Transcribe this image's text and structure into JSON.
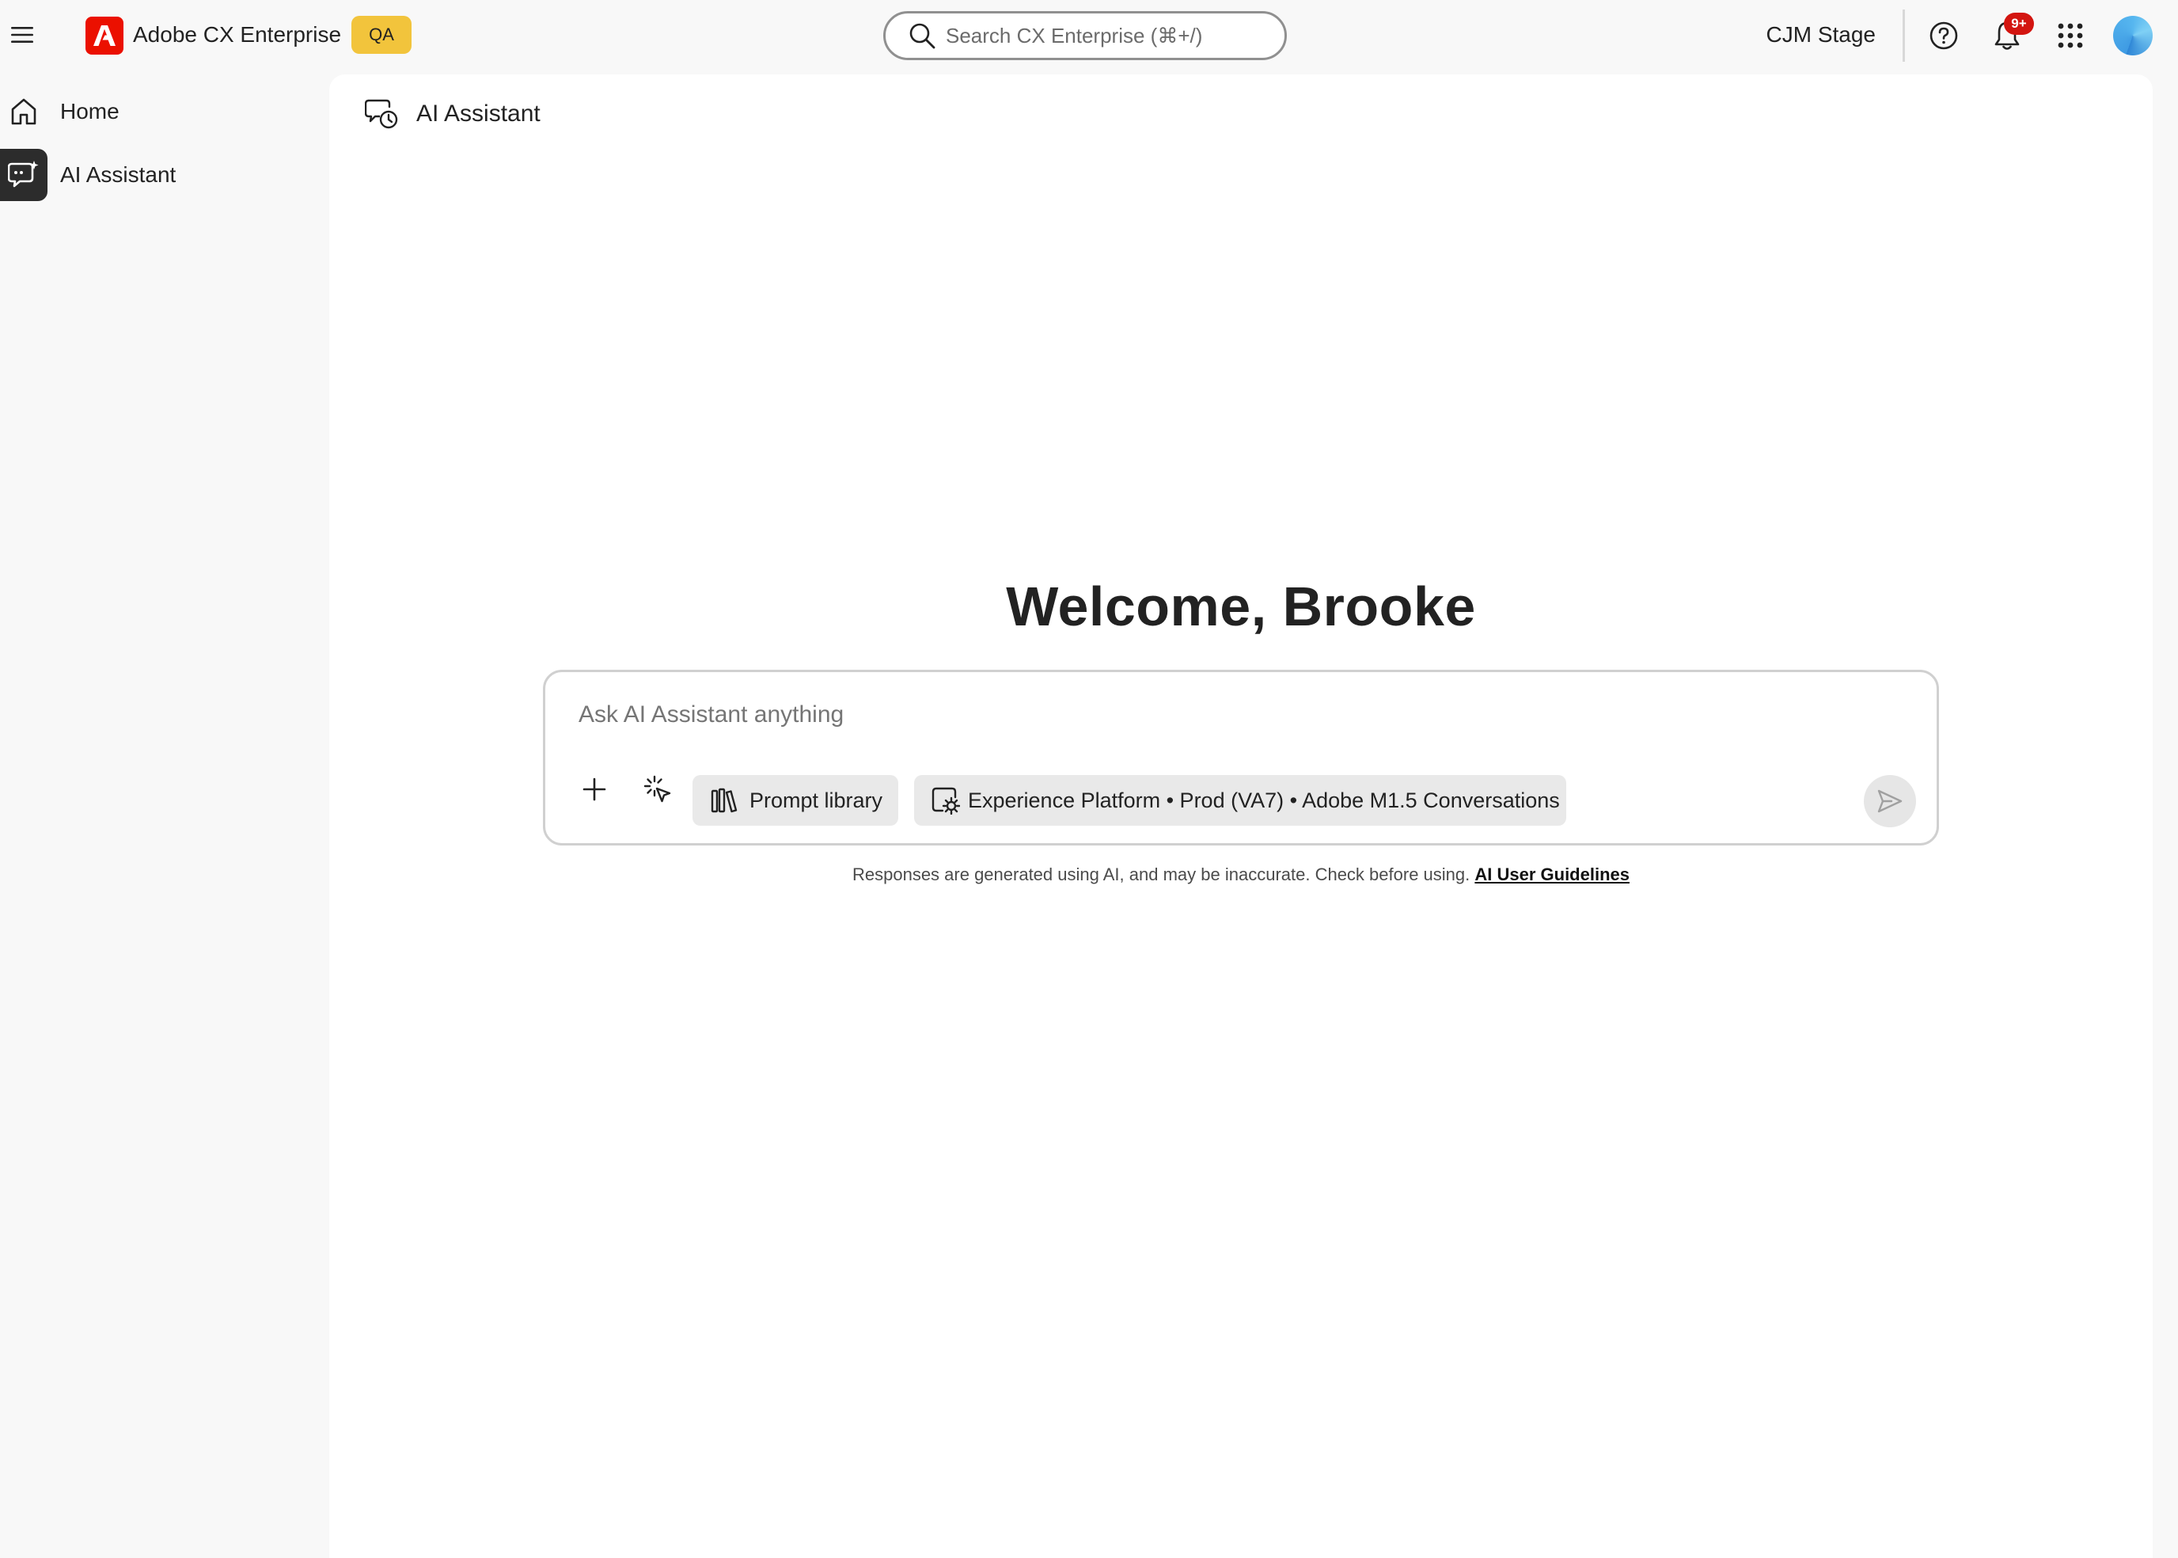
{
  "app": {
    "name": "Adobe CX Enterprise",
    "env_badge": "QA",
    "brand_color": "#eb1000",
    "badge_color": "#f2c43c"
  },
  "header": {
    "search_placeholder": "Search CX Enterprise (⌘+/)",
    "org_name": "CJM Stage",
    "notification_count": "9+",
    "icons": [
      "menu-icon",
      "adobe-logo-icon",
      "search-icon",
      "help-icon",
      "bell-icon",
      "apps-grid-icon",
      "avatar"
    ]
  },
  "sidebar": {
    "items": [
      {
        "label": "Home",
        "icon": "home-icon",
        "active": false
      },
      {
        "label": "AI Assistant",
        "icon": "ai-assistant-icon",
        "active": true
      }
    ]
  },
  "main": {
    "title": "AI Assistant",
    "welcome": "Welcome, Brooke",
    "composer": {
      "placeholder": "Ask AI Assistant anything",
      "prompt_library_label": "Prompt library",
      "context_label": "Experience Platform • Prod (VA7) • Adobe M1.5 Conversations"
    },
    "disclaimer": {
      "text": "Responses are generated using AI, and may be inaccurate. Check before using.",
      "link_label": "AI User Guidelines"
    }
  }
}
